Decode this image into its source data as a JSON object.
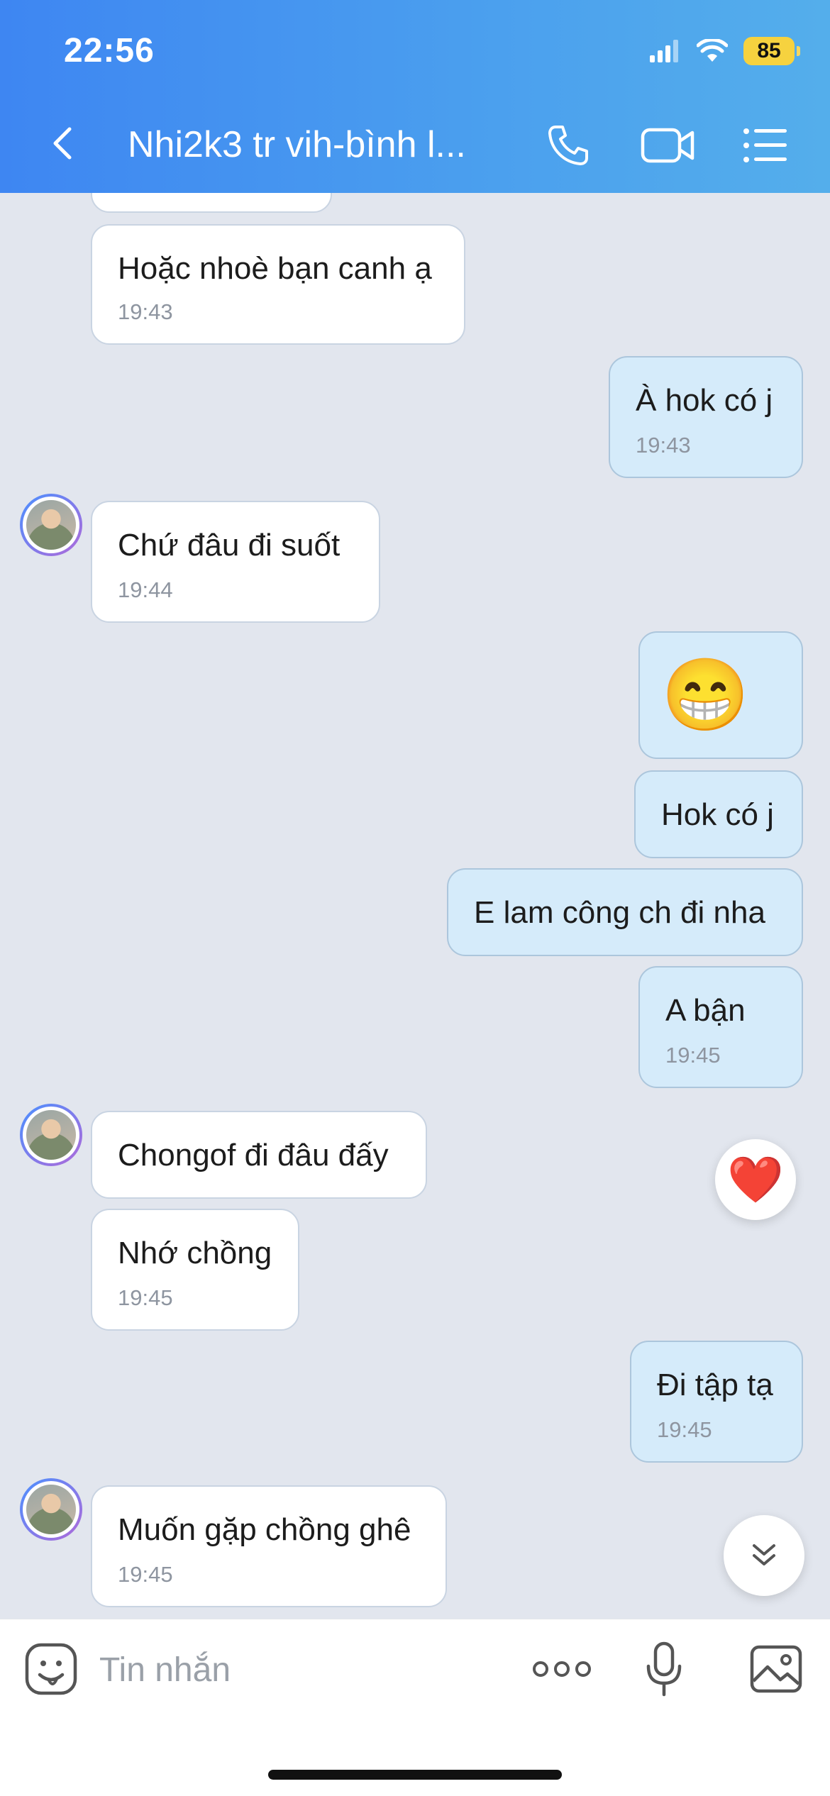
{
  "status_bar": {
    "time": "22:56",
    "battery": "85"
  },
  "header": {
    "title": "Nhi2k3 tr vih-bình l..."
  },
  "messages": [
    {
      "dir": "in",
      "text": "Hoặc nhoè bạn canh ạ",
      "time": "19:43"
    },
    {
      "dir": "out",
      "text": "À hok có j",
      "time": "19:43"
    },
    {
      "dir": "in",
      "text": "Chứ đâu đi suốt",
      "time": "19:44"
    },
    {
      "dir": "out",
      "text": "😁",
      "time": ""
    },
    {
      "dir": "out",
      "text": "Hok có j",
      "time": ""
    },
    {
      "dir": "out",
      "text": "E lam công ch đi nha",
      "time": ""
    },
    {
      "dir": "out",
      "text": "A bận",
      "time": "19:45"
    },
    {
      "dir": "in",
      "text": "Chongof đi đâu đấy",
      "time": ""
    },
    {
      "dir": "in",
      "text": "Nhớ chồng",
      "time": "19:45"
    },
    {
      "dir": "out",
      "text": "Đi tập tạ",
      "time": "19:45"
    },
    {
      "dir": "in",
      "text": "Muốn gặp chồng ghê",
      "time": "19:45"
    }
  ],
  "reaction": {
    "emoji": "❤️"
  },
  "composer": {
    "placeholder": "Tin nhắn"
  },
  "icons": {
    "back": "chevron-left-icon",
    "call": "phone-icon",
    "video": "video-camera-icon",
    "menu": "list-menu-icon",
    "sticker": "sticker-face-icon",
    "more": "more-dots-icon",
    "mic": "microphone-icon",
    "image": "image-icon",
    "scroll_down": "chevrons-down-icon"
  }
}
